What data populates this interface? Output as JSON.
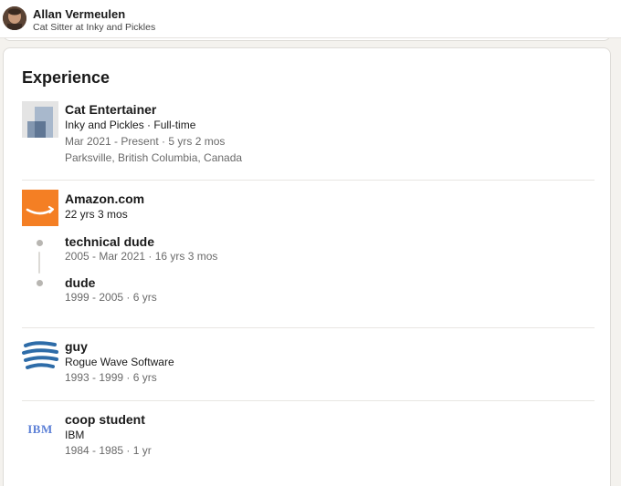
{
  "header": {
    "name": "Allan Vermeulen",
    "headline": "Cat Sitter at Inky and Pickles"
  },
  "experience": {
    "title": "Experience",
    "entries": [
      {
        "logo": "inky-and-pickles-logo",
        "title": "Cat Entertainer",
        "company_line": "Inky and Pickles · Full-time",
        "dates": "Mar 2021 - Present · 5 yrs 2 mos",
        "location": "Parksville, British Columbia, Canada"
      },
      {
        "logo": "amazon-logo",
        "company": "Amazon.com",
        "total_duration": "22 yrs 3 mos",
        "roles": [
          {
            "title": "technical dude",
            "dates": "2005 - Mar 2021 · 16 yrs 3 mos"
          },
          {
            "title": "dude",
            "dates": "1999 - 2005 · 6 yrs"
          }
        ]
      },
      {
        "logo": "rogue-wave-logo",
        "title": "guy",
        "company_line": "Rogue Wave Software",
        "dates": "1993 - 1999 · 6 yrs"
      },
      {
        "logo": "ibm-logo",
        "logo_text": "IBM",
        "title": "coop student",
        "company_line": "IBM",
        "dates": "1984 - 1985 · 1 yr"
      }
    ]
  },
  "colors": {
    "amazon_orange": "#f47f24",
    "rogue_wave_blue": "#2e6ca8",
    "ibm_blue": "#5b7fd6"
  }
}
